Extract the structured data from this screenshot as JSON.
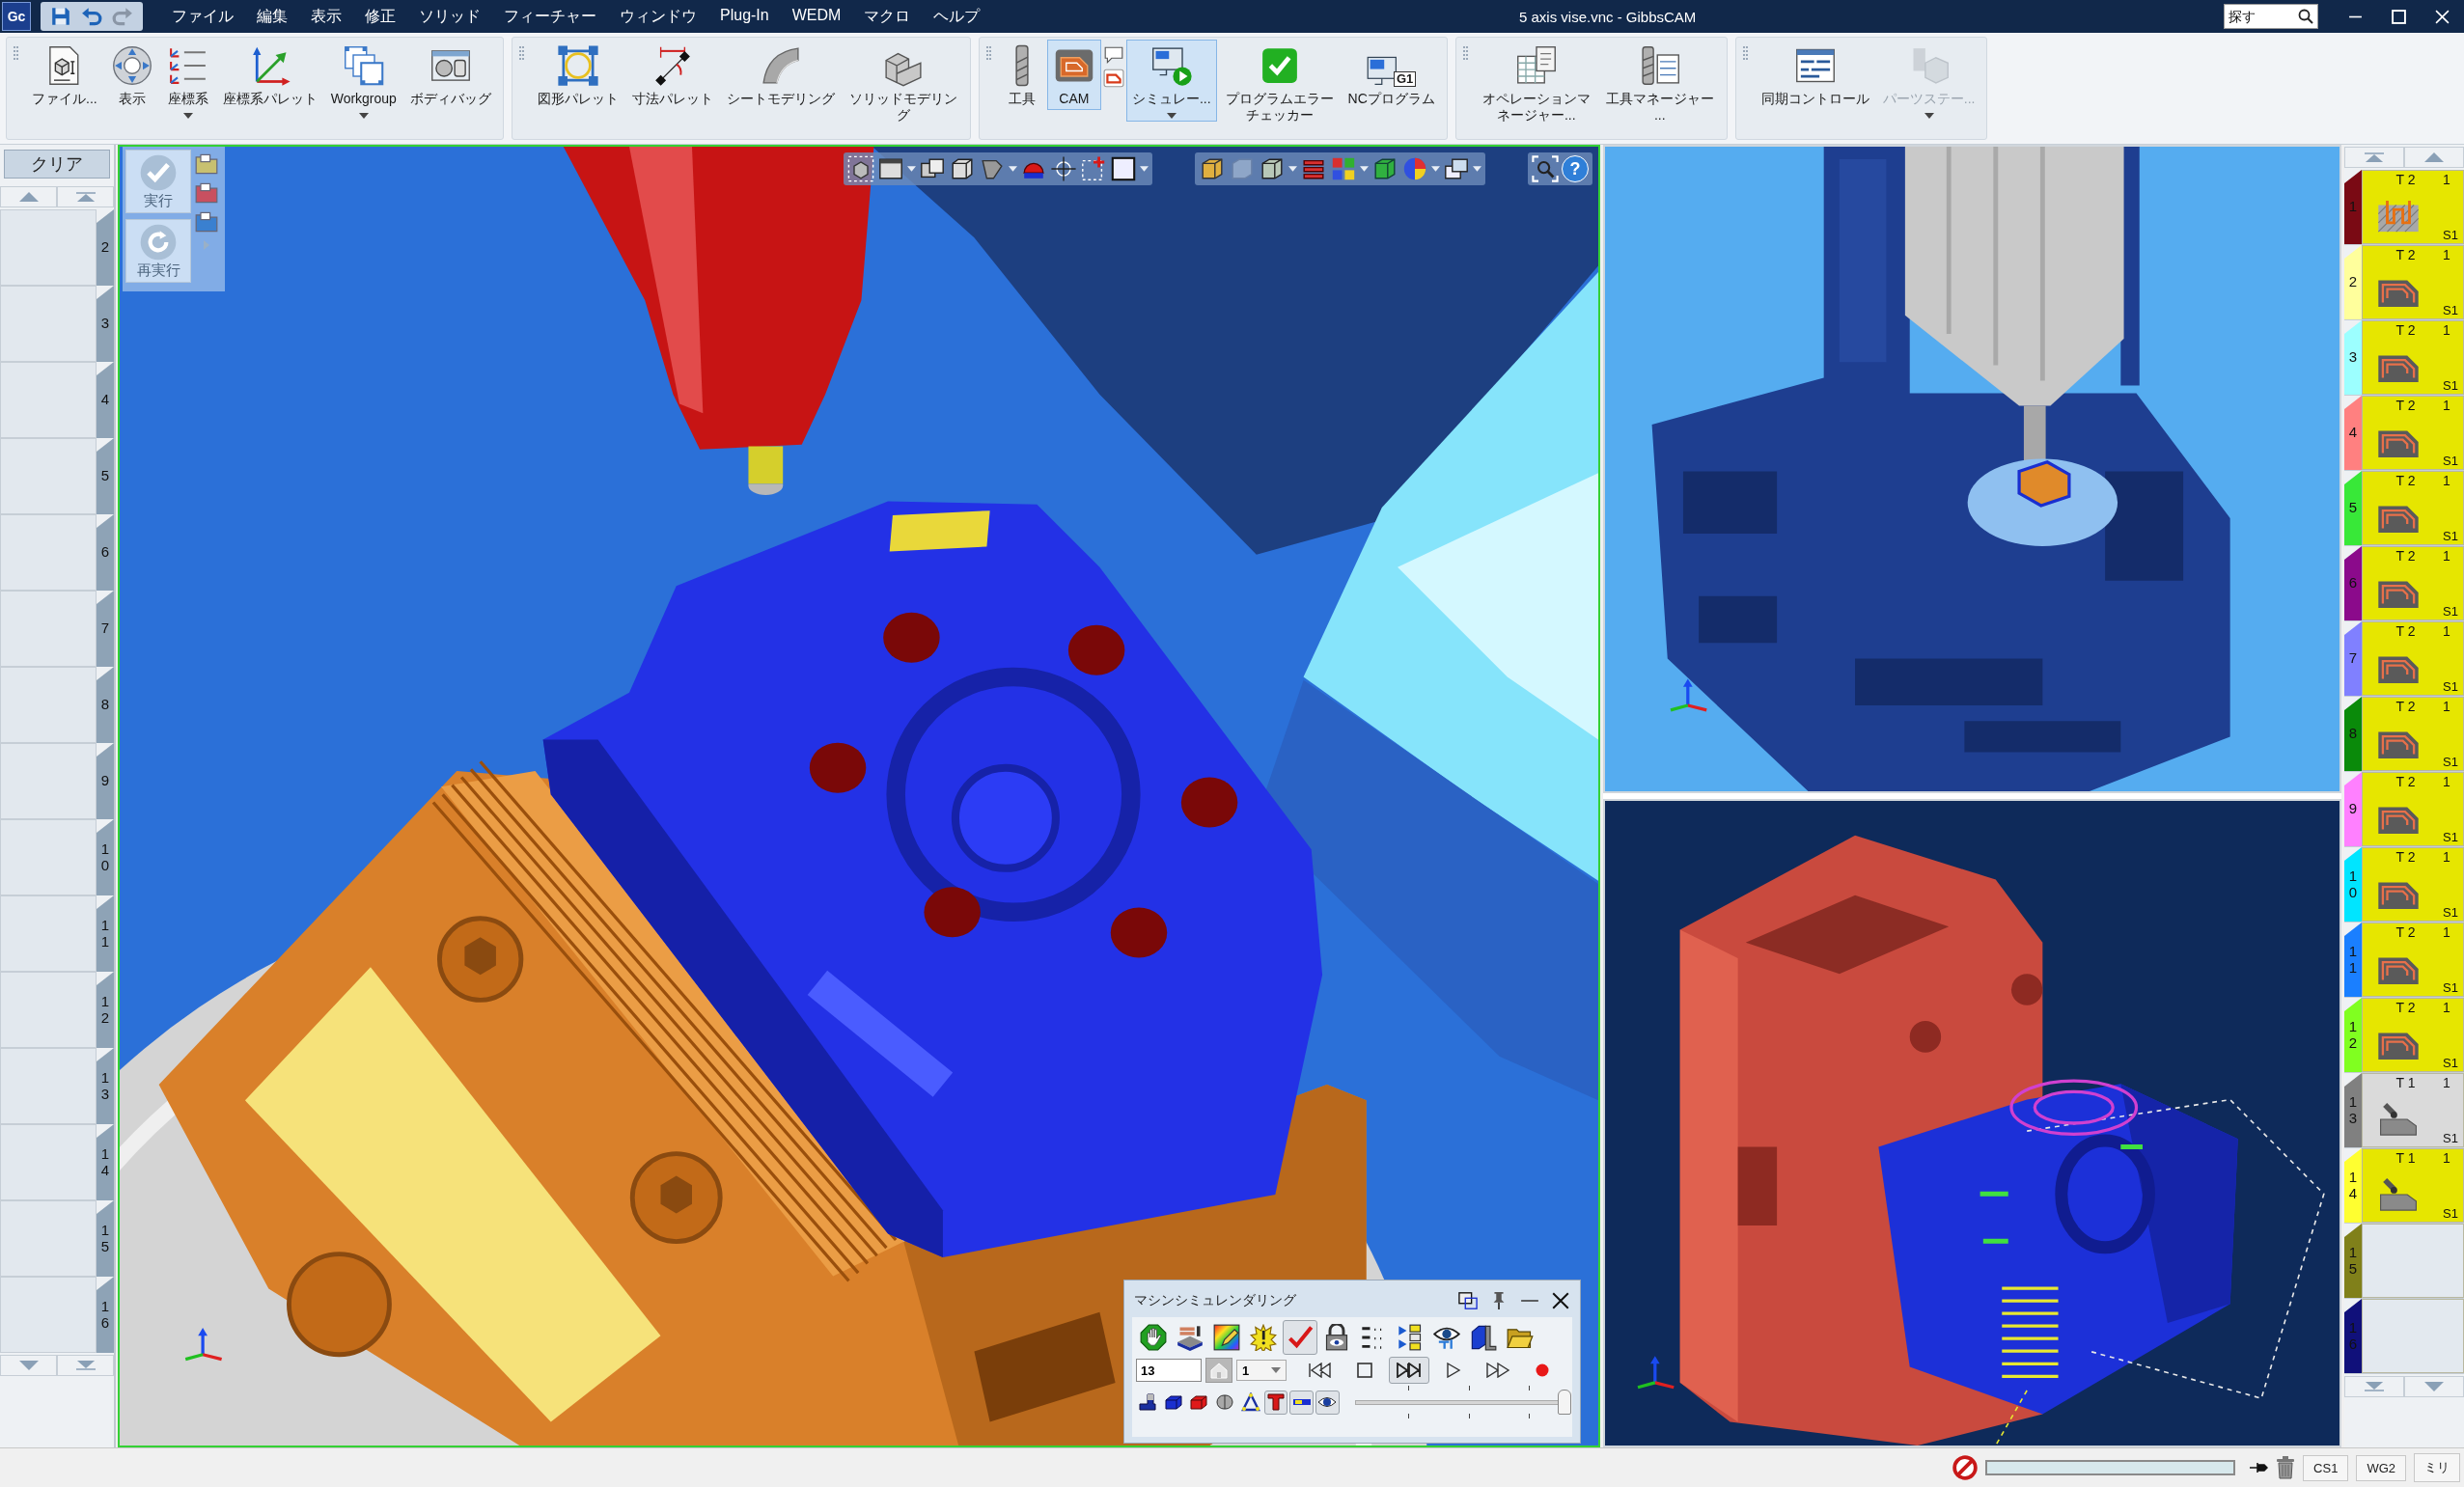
{
  "title_bar": {
    "app_icon": "Gc",
    "quick_access": [
      {
        "kind": "save",
        "disabled": false
      },
      {
        "kind": "undo",
        "disabled": false
      },
      {
        "kind": "redo",
        "disabled": true
      }
    ],
    "menu": [
      "ファイル",
      "編集",
      "表示",
      "修正",
      "ソリッド",
      "フィーチャー",
      "ウィンドウ",
      "Plug-In",
      "WEDM",
      "マクロ",
      "ヘルプ"
    ],
    "title": "5 axis vise.vnc - GibbsCAM",
    "search": {
      "placeholder": "探す"
    }
  },
  "ribbon": {
    "groups": [
      {
        "items": [
          {
            "kind": "file",
            "label": "ファイル...",
            "selected": false,
            "disabled": false,
            "dropdown": false
          },
          {
            "kind": "view",
            "label": "表示",
            "selected": false,
            "disabled": false,
            "dropdown": false
          },
          {
            "kind": "cs",
            "label": "座標系",
            "selected": false,
            "disabled": false,
            "dropdown": true
          },
          {
            "kind": "cs-palette",
            "label": "座標系パレット",
            "selected": false,
            "disabled": false,
            "dropdown": false
          },
          {
            "kind": "workgroup",
            "label": "Workgroup",
            "selected": false,
            "disabled": false,
            "dropdown": true
          },
          {
            "kind": "bodybag",
            "label": "ボディバッグ",
            "selected": false,
            "disabled": false,
            "dropdown": false
          }
        ]
      },
      {
        "items": [
          {
            "kind": "geometry",
            "label": "図形パレット",
            "selected": false,
            "disabled": false,
            "dropdown": false
          },
          {
            "kind": "dimension",
            "label": "寸法パレット",
            "selected": false,
            "disabled": false,
            "dropdown": false
          },
          {
            "kind": "sheet",
            "label": "シートモデリング",
            "selected": false,
            "disabled": false,
            "dropdown": false
          },
          {
            "kind": "solid",
            "label": "ソリッドモデリング",
            "selected": false,
            "disabled": false,
            "dropdown": false
          }
        ]
      },
      {
        "items": [
          {
            "kind": "tool",
            "label": "工具",
            "selected": false,
            "disabled": false,
            "dropdown": false
          },
          {
            "kind": "cam",
            "label": "CAM",
            "selected": true,
            "disabled": false,
            "dropdown": false
          },
          {
            "kind": "simulation",
            "label": "シミュレー...",
            "selected": true,
            "disabled": false,
            "dropdown": true
          },
          {
            "kind": "checker",
            "label": "プログラムエラーチェッカー",
            "selected": false,
            "disabled": false,
            "dropdown": false
          },
          {
            "kind": "nc",
            "label": "NCプログラム",
            "badge": "G1",
            "selected": false,
            "disabled": false,
            "dropdown": false
          }
        ]
      },
      {
        "items": [
          {
            "kind": "op-manager",
            "label": "オペレーションマネージャー...",
            "selected": false,
            "disabled": false,
            "dropdown": false
          },
          {
            "kind": "tool-manager",
            "label": "工具マネージャー...",
            "selected": false,
            "disabled": false,
            "dropdown": false
          }
        ]
      },
      {
        "items": [
          {
            "kind": "sync",
            "label": "同期コントロール",
            "selected": false,
            "disabled": false,
            "dropdown": false
          },
          {
            "kind": "parts",
            "label": "パーツステー...",
            "selected": false,
            "disabled": true,
            "dropdown": true
          }
        ]
      }
    ]
  },
  "left_panel": {
    "clear_button": "クリア",
    "slots": [
      {
        "number": "2"
      },
      {
        "number": "3"
      },
      {
        "number": "4"
      },
      {
        "number": "5"
      },
      {
        "number": "6"
      },
      {
        "number": "7"
      },
      {
        "number": "8"
      },
      {
        "number": "9"
      },
      {
        "number": "10"
      },
      {
        "number": "11"
      },
      {
        "number": "12"
      },
      {
        "number": "13"
      },
      {
        "number": "14"
      },
      {
        "number": "15"
      },
      {
        "number": "16"
      }
    ]
  },
  "viewports": [
    {
      "kind": "vise-closeup",
      "active": true
    },
    {
      "kind": "machine",
      "active": false
    },
    {
      "kind": "section",
      "active": false
    }
  ],
  "view_toolbar": {
    "help": "?"
  },
  "execute_panel": {
    "buttons": [
      {
        "kind": "run",
        "label": "実行",
        "disabled": true
      },
      {
        "kind": "rerun",
        "label": "再実行",
        "disabled": true
      }
    ]
  },
  "simulation_dialog": {
    "title": "マシンシミュレンダリング",
    "tools": [
      {
        "kind": "hand",
        "selected": false
      },
      {
        "kind": "machine",
        "selected": false
      },
      {
        "kind": "palette",
        "selected": false
      },
      {
        "kind": "burst",
        "selected": false
      },
      {
        "kind": "check",
        "selected": true
      },
      {
        "kind": "lock",
        "selected": false
      },
      {
        "kind": "coords",
        "selected": false
      },
      {
        "kind": "list",
        "selected": false
      },
      {
        "kind": "eye",
        "selected": false
      },
      {
        "kind": "block",
        "selected": false
      },
      {
        "kind": "folder",
        "selected": false
      }
    ],
    "operation_field": {
      "value": "13"
    },
    "home_button": {
      "disabled": true
    },
    "dropdown": {
      "value": "1"
    },
    "transport": [
      {
        "kind": "to-start",
        "selected": false
      },
      {
        "kind": "stop",
        "selected": false
      },
      {
        "kind": "step",
        "selected": true
      },
      {
        "kind": "play",
        "selected": false
      },
      {
        "kind": "fast-forward",
        "selected": false
      },
      {
        "kind": "record",
        "selected": false
      }
    ],
    "display": [
      {
        "kind": "fixture",
        "selected": false
      },
      {
        "kind": "stock",
        "selected": false
      },
      {
        "kind": "part",
        "selected": false
      },
      {
        "kind": "cylinder",
        "selected": false
      },
      {
        "kind": "triangle",
        "selected": false
      },
      {
        "kind": "tool",
        "selected": true
      },
      {
        "kind": "holder",
        "selected": true
      },
      {
        "kind": "eye",
        "selected": true
      }
    ],
    "slider": {
      "level": 1
    }
  },
  "operations": [
    {
      "number": "1",
      "color": "#7a0a14",
      "kind": "pocket",
      "tool": "T 2",
      "count": "1",
      "spindle": "S1",
      "selected": true
    },
    {
      "number": "2",
      "color": "#ffff9c",
      "kind": "contour",
      "tool": "T 2",
      "count": "1",
      "spindle": "S1",
      "selected": true
    },
    {
      "number": "3",
      "color": "#9cffff",
      "kind": "contour",
      "tool": "T 2",
      "count": "1",
      "spindle": "S1",
      "selected": true
    },
    {
      "number": "4",
      "color": "#ff8080",
      "kind": "contour",
      "tool": "T 2",
      "count": "1",
      "spindle": "S1",
      "selected": true
    },
    {
      "number": "5",
      "color": "#38e838",
      "kind": "contour",
      "tool": "T 2",
      "count": "1",
      "spindle": "S1",
      "selected": true
    },
    {
      "number": "6",
      "color": "#8b0a8b",
      "kind": "contour",
      "tool": "T 2",
      "count": "1",
      "spindle": "S1",
      "selected": true
    },
    {
      "number": "7",
      "color": "#8080ff",
      "kind": "contour",
      "tool": "T 2",
      "count": "1",
      "spindle": "S1",
      "selected": true
    },
    {
      "number": "8",
      "color": "#0a8a0a",
      "kind": "contour",
      "tool": "T 2",
      "count": "1",
      "spindle": "S1",
      "selected": true
    },
    {
      "number": "9",
      "color": "#ff80ff",
      "kind": "contour",
      "tool": "T 2",
      "count": "1",
      "spindle": "S1",
      "selected": true
    },
    {
      "number": "10",
      "color": "#00e5ff",
      "kind": "contour",
      "tool": "T 2",
      "count": "1",
      "spindle": "S1",
      "selected": true
    },
    {
      "number": "11",
      "color": "#1a7fff",
      "kind": "contour",
      "tool": "T 2",
      "count": "1",
      "spindle": "S1",
      "selected": true
    },
    {
      "number": "12",
      "color": "#80ff20",
      "kind": "contour",
      "tool": "T 2",
      "count": "1",
      "spindle": "S1",
      "selected": true
    },
    {
      "number": "13",
      "color": "#808080",
      "kind": "drill",
      "tool": "T 1",
      "count": "1",
      "spindle": "S1",
      "selected": false
    },
    {
      "number": "14",
      "color": "#ffff30",
      "kind": "drill",
      "tool": "T 1",
      "count": "1",
      "spindle": "S1",
      "selected": true
    },
    {
      "number": "15",
      "color": "#80801a",
      "kind": "empty",
      "selected": false
    },
    {
      "number": "16",
      "color": "#10107a",
      "kind": "empty",
      "selected": false
    }
  ],
  "status_bar": {
    "progress": {
      "level": 0
    },
    "fields": [
      "CS1",
      "WG2",
      "ミリ"
    ]
  }
}
